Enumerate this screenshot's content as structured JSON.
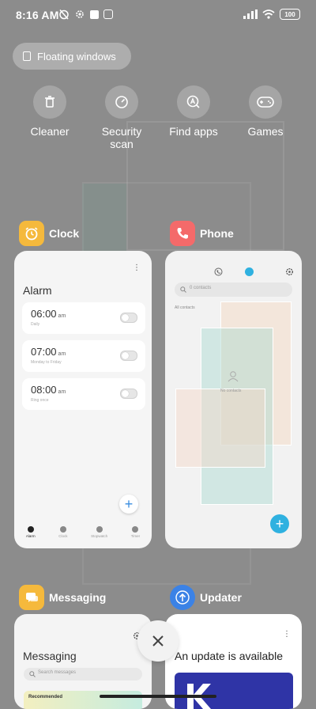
{
  "status_bar": {
    "time": "8:16 AM",
    "battery": "100"
  },
  "floating_windows": {
    "label": "Floating windows",
    "icon": "floating-window-icon"
  },
  "quick_actions": [
    {
      "label": "Cleaner",
      "icon": "trash-icon"
    },
    {
      "label": "Security\nscan",
      "icon": "security-scan-icon"
    },
    {
      "label": "Find apps",
      "icon": "find-apps-icon"
    },
    {
      "label": "Games",
      "icon": "gamepad-icon"
    }
  ],
  "apps": {
    "clock": {
      "name": "Clock",
      "color": "#f5b93c",
      "title": "Alarm",
      "alarms": [
        {
          "time": "06:00",
          "ampm": "am",
          "sub": "Daily"
        },
        {
          "time": "07:00",
          "ampm": "am",
          "sub": "Monday to Friday"
        },
        {
          "time": "08:00",
          "ampm": "am",
          "sub": "Ring once"
        }
      ],
      "tabs": [
        "Alarm",
        "Clock",
        "Stopwatch",
        "Timer"
      ]
    },
    "phone": {
      "name": "Phone",
      "color": "#f46a6a",
      "search_placeholder": "0 contacts",
      "all_contacts": "All contacts",
      "no_contacts": "No contacts",
      "accent": "#2fb1e0"
    },
    "messaging": {
      "name": "Messaging",
      "color": "#f5b93c",
      "title": "Messaging",
      "search_placeholder": "Search messages",
      "recommended": "Recommended"
    },
    "updater": {
      "name": "Updater",
      "color": "#3b82e6",
      "title": "An update is available"
    }
  }
}
